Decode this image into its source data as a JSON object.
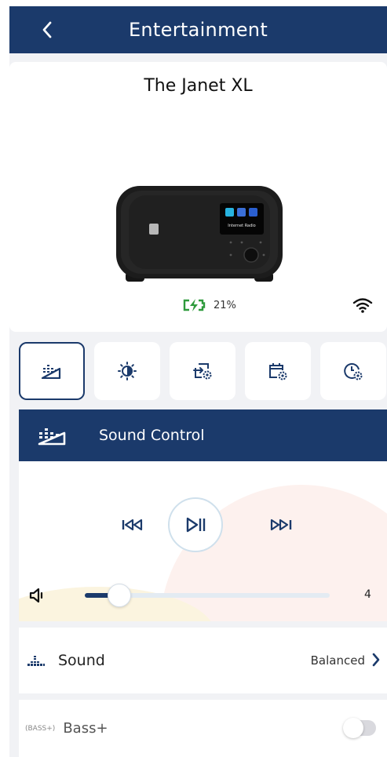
{
  "header": {
    "title": "Entertainment",
    "back_icon": "chevron-left-icon"
  },
  "device": {
    "name": "The Janet XL",
    "screen_text": "Internet Radio",
    "battery_percent": "21%",
    "battery_icon": "battery-charging-icon",
    "wifi_icon": "wifi-icon"
  },
  "tabs": [
    {
      "name": "sound-control",
      "icon": "equalizer-icon",
      "active": true
    },
    {
      "name": "brightness",
      "icon": "brightness-icon",
      "active": false
    },
    {
      "name": "input-settings",
      "icon": "input-settings-icon",
      "active": false
    },
    {
      "name": "calendar-settings",
      "icon": "calendar-settings-icon",
      "active": false
    },
    {
      "name": "timer-settings",
      "icon": "clock-settings-icon",
      "active": false
    }
  ],
  "section": {
    "title": "Sound Control",
    "icon": "equalizer-icon"
  },
  "player": {
    "volume_value": "4",
    "volume_fraction": 0.14,
    "prev_icon": "skip-previous-icon",
    "play_icon": "play-pause-icon",
    "next_icon": "skip-next-icon",
    "volume_icon": "speaker-icon"
  },
  "sound": {
    "label": "Sound",
    "value": "Balanced",
    "icon": "bars-icon"
  },
  "bass": {
    "label": "Bass+",
    "badge": "(BASS+)",
    "enabled": false
  },
  "colors": {
    "primary": "#1b3a6b",
    "battery": "#2e9a3c",
    "background": "#f1f2f5"
  }
}
